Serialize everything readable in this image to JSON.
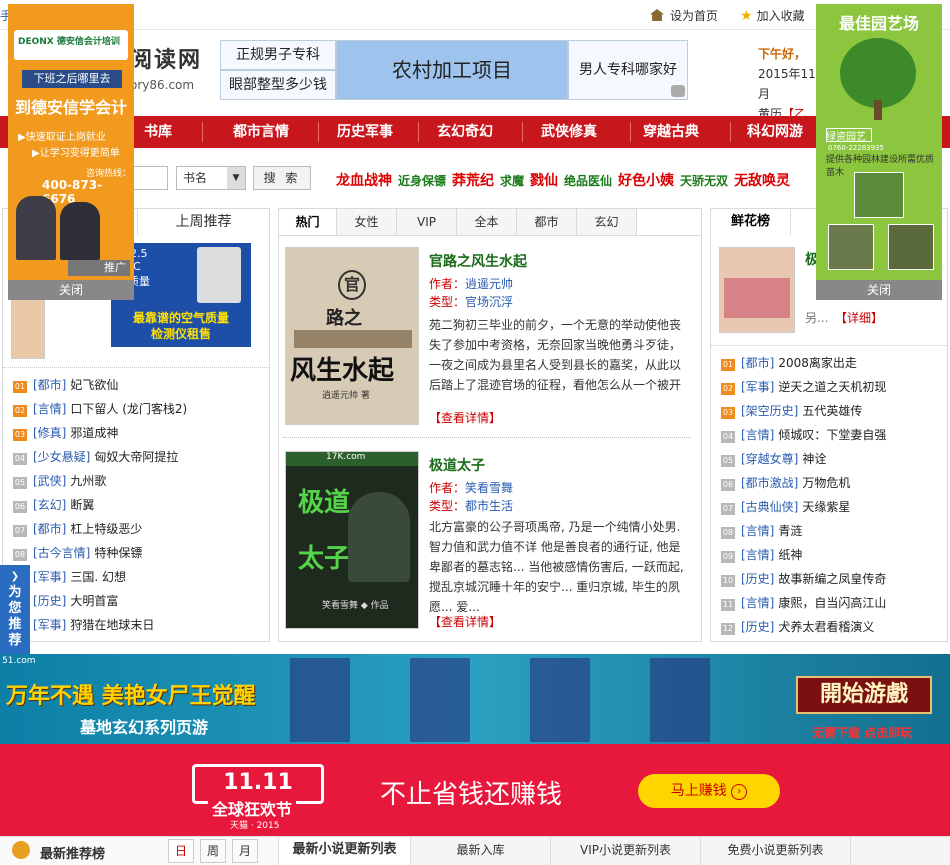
{
  "topbar": {
    "left_fragment": "手",
    "set_home": "设为首页",
    "add_fav": "加入收藏"
  },
  "header": {
    "logo_text": "阅读网",
    "logo_url_fragment": "ory86.com",
    "text_ads": [
      "正规男子专科",
      "眼部整型多少钱",
      "农村加工项目",
      "男人专科哪家好"
    ],
    "greeting": {
      "line1": "下午好，",
      "line2": "2015年11月",
      "line3": "黄历",
      "line3b": "【乙"
    }
  },
  "nav": {
    "items": [
      "书库",
      "都市言情",
      "历史军事",
      "玄幻奇幻",
      "武侠修真",
      "穿越古典",
      "科幻网游"
    ]
  },
  "search": {
    "select_value": "书名",
    "button_label": "搜 索"
  },
  "hotlinks": [
    {
      "text": "龙血战神",
      "big": true
    },
    {
      "text": "近身保镖",
      "big": false
    },
    {
      "text": "莽荒纪",
      "big": true
    },
    {
      "text": "求魔",
      "big": false
    },
    {
      "text": "戮仙",
      "big": true
    },
    {
      "text": "绝品医仙",
      "big": false
    },
    {
      "text": "好色小姨",
      "big": true
    },
    {
      "text": "天骄无双",
      "big": false
    },
    {
      "text": "无敌唤灵",
      "big": true
    }
  ],
  "left_panel": {
    "tab_label": "上周推荐",
    "ad_air": {
      "line1": "M 2.5",
      "line2": "VOC",
      "line3": "气质量",
      "line4": "最靠谱的空气质量",
      "line5": "检测仪租售"
    },
    "rank": [
      {
        "num": "01",
        "cat": "[都市]",
        "title": "妃飞欲仙"
      },
      {
        "num": "02",
        "cat": "[言情]",
        "title": "口下留人 (龙门客栈2)"
      },
      {
        "num": "03",
        "cat": "[修真]",
        "title": "邪道成神"
      },
      {
        "num": "04",
        "cat": "[少女悬疑]",
        "title": "匈奴大帝阿提拉"
      },
      {
        "num": "05",
        "cat": "[武侠]",
        "title": "九州歌"
      },
      {
        "num": "06",
        "cat": "[玄幻]",
        "title": "断翼"
      },
      {
        "num": "07",
        "cat": "[都市]",
        "title": "杠上特级恶少"
      },
      {
        "num": "08",
        "cat": "[古今言情]",
        "title": "特种保镖"
      },
      {
        "num": "09",
        "cat": "[军事]",
        "title": "三国. 幻想"
      },
      {
        "num": "10",
        "cat": "[历史]",
        "title": "大明首富"
      },
      {
        "num": "11",
        "cat": "[军事]",
        "title": "狩猎在地球末日"
      }
    ]
  },
  "center_panel": {
    "tabs": [
      "热门",
      "女性",
      "VIP",
      "全本",
      "都市",
      "玄幻"
    ],
    "books": [
      {
        "title": "官路之风生水起",
        "author_label": "作者：",
        "author": "逍遥元帅",
        "type_label": "类型：",
        "type": "官场沉浮",
        "desc": "苑二狗初三毕业的前夕，一个无意的举动使他丧失了参加中考资格，无奈回家当晚他勇斗歹徒，一夜之间成为县里名人受到县长的嘉奖，从此以后踏上了混迹官场的征程，看他怎么从一个被开除的学生爬到官场上混的风...",
        "more": "【查看详情】",
        "cover_text1": "官",
        "cover_text2": "路之",
        "cover_text3": "风生水起",
        "cover_text4": "逍遥元帅 著"
      },
      {
        "title": "极道太子",
        "author_label": "作者：",
        "author": "笑看雪舞",
        "type_label": "类型：",
        "type": "都市生活",
        "desc": "北方富豪的公子哥项禹帝, 乃是一个纯情小处男. 智力值和武力值不详  他是善良者的通行证, 他是卑鄙者的墓志铭...  当他被感情伤害后, 一跃而起, 搅乱京城沉睡十年的安宁...  重归京城, 毕生的夙愿...     爱...",
        "more": "【查看详情】",
        "cover_text1": "17K.com",
        "cover_text2": "极道",
        "cover_text3": "太子",
        "cover_text4": "笑看雪舞 ◆ 作品"
      }
    ]
  },
  "right_panel": {
    "tab_label": "鲜花榜",
    "feature": {
      "title_frag": "极",
      "desc_frag": "另...",
      "more": "【详细】"
    },
    "rank": [
      {
        "num": "01",
        "cat": "[都市]",
        "title": "2008离家出走"
      },
      {
        "num": "02",
        "cat": "[军事]",
        "title": "逆天之道之天机初现"
      },
      {
        "num": "03",
        "cat": "[架空历史]",
        "title": "五代英雄传"
      },
      {
        "num": "04",
        "cat": "[言情]",
        "title": "倾城叹：下堂妻自强"
      },
      {
        "num": "05",
        "cat": "[穿越女尊]",
        "title": "神诠"
      },
      {
        "num": "06",
        "cat": "[都市激战]",
        "title": "万物危机"
      },
      {
        "num": "07",
        "cat": "[古典仙侠]",
        "title": "天缘紫星"
      },
      {
        "num": "08",
        "cat": "[言情]",
        "title": "青涟"
      },
      {
        "num": "09",
        "cat": "[言情]",
        "title": "纸神"
      },
      {
        "num": "10",
        "cat": "[历史]",
        "title": "故事新编之凤皇传奇"
      },
      {
        "num": "11",
        "cat": "[言情]",
        "title": "康熙，自当闪高江山"
      },
      {
        "num": "12",
        "cat": "[历史]",
        "title": "犬养太君看稽演义"
      }
    ]
  },
  "float_ad_left": {
    "brand": "DEONX 德安信会计培训",
    "line1": "下班之后哪里去",
    "line2": "到德安信学会计",
    "line3": "▶快速取证上岗就业",
    "line4": "▶让学习变得更简单",
    "phone_label": "咨询热线：",
    "phone": "400-873-6676",
    "promo": "推广",
    "close": "关闭"
  },
  "float_ad_right": {
    "title": "最佳园艺场",
    "sub": "绿资园艺",
    "phone": "0760-22283935",
    "desc": "提供各种园林建设所需优质苗木",
    "close": "关闭"
  },
  "side_tab": {
    "text": "为您推荐"
  },
  "banner_game": {
    "headline": "万年不遇  美艳女尸王觉醒",
    "sub": "墓地玄幻系列页游",
    "button": "開始游戲",
    "note": "无需下载  点击即玩",
    "corner": "51.com"
  },
  "banner_tmall": {
    "tag": "11.11",
    "event": "全球狂欢节",
    "brand": "天猫 · 2015",
    "slogan": "不止省钱还赚钱",
    "button": "马上赚钱"
  },
  "bottom": {
    "left_title": "最新推荐榜",
    "left_tabs": [
      "日",
      "周",
      "月"
    ],
    "right_tabs": [
      "最新小说更新列表",
      "最新入库",
      "VIP小说更新列表",
      "免费小说更新列表"
    ]
  },
  "colors": {
    "nav_red": "#c8161d",
    "orange_ad": "#f29a1d",
    "green_ad": "#8cc63e",
    "tmall_red": "#e8173c"
  }
}
